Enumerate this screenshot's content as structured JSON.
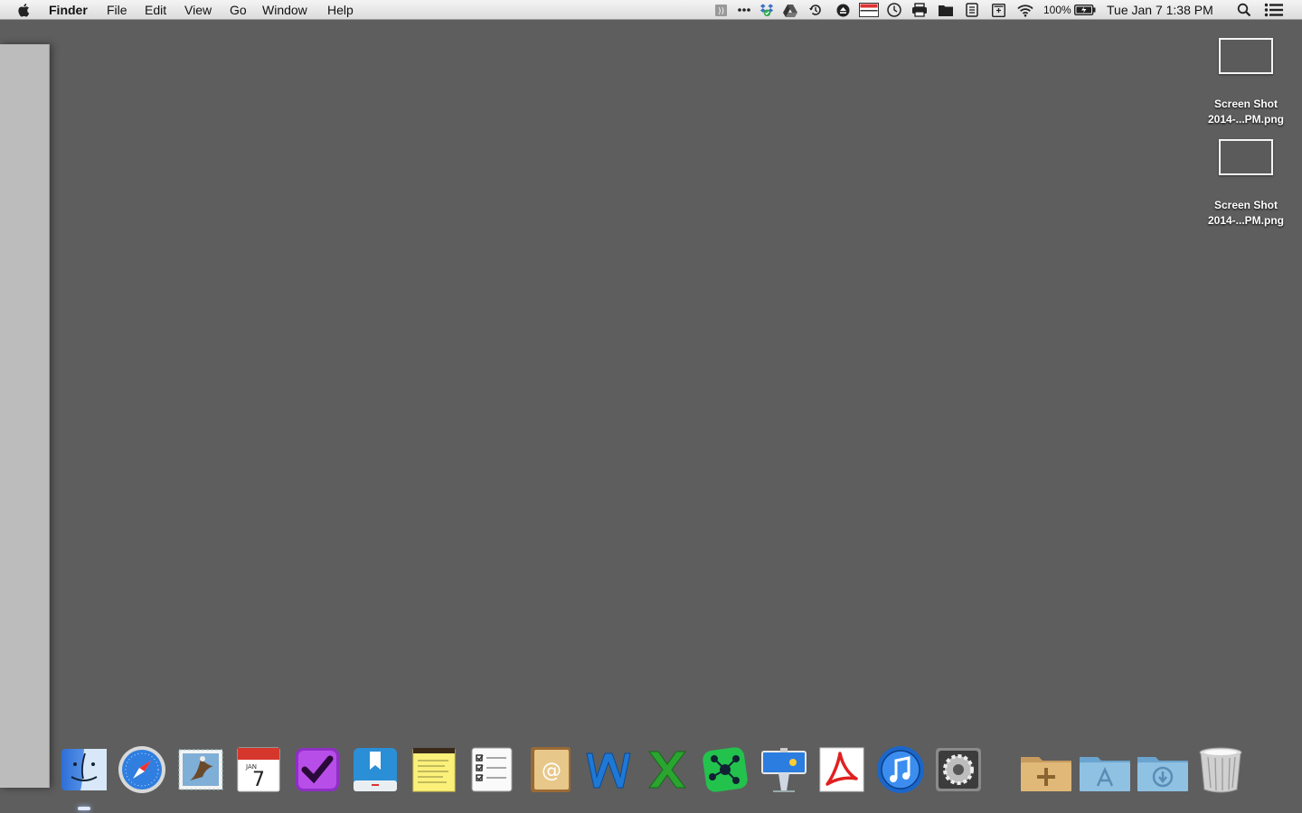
{
  "menubar": {
    "app_name": "Finder",
    "menus": [
      "File",
      "Edit",
      "View",
      "Go",
      "Window",
      "Help"
    ],
    "battery_percent": "100%",
    "datetime": "Tue Jan 7  1:38 PM",
    "status_icons": [
      "bracket-icon",
      "more-icon",
      "dropbox-icon",
      "google-drive-icon",
      "time-machine-icon",
      "eject-icon",
      "display-icon",
      "clock-icon",
      "printer-icon",
      "folder-icon",
      "clipboard-icon",
      "calculator-icon",
      "wifi-icon",
      "battery-icon",
      "spotlight-icon",
      "notification-center-icon"
    ]
  },
  "desktop": {
    "files": [
      {
        "line1": "Screen Shot",
        "line2": "2014-...PM.png"
      },
      {
        "line1": "Screen Shot",
        "line2": "2014-...PM.png"
      }
    ]
  },
  "dock": {
    "apps": [
      "finder",
      "safari",
      "mail",
      "calendar",
      "omnifocus",
      "day-one",
      "stickies",
      "reminders",
      "contacts",
      "word",
      "excel",
      "mindnode",
      "keynote",
      "acrobat",
      "itunes",
      "system-preferences"
    ],
    "stacks": [
      "applications-folder",
      "app-store-folder",
      "downloads-folder"
    ],
    "trash": "trash",
    "calendar_month": "JAN",
    "calendar_day": "7"
  },
  "colors": {
    "desktop": "#5e5e5e",
    "menubar": "#e8e8e8"
  }
}
